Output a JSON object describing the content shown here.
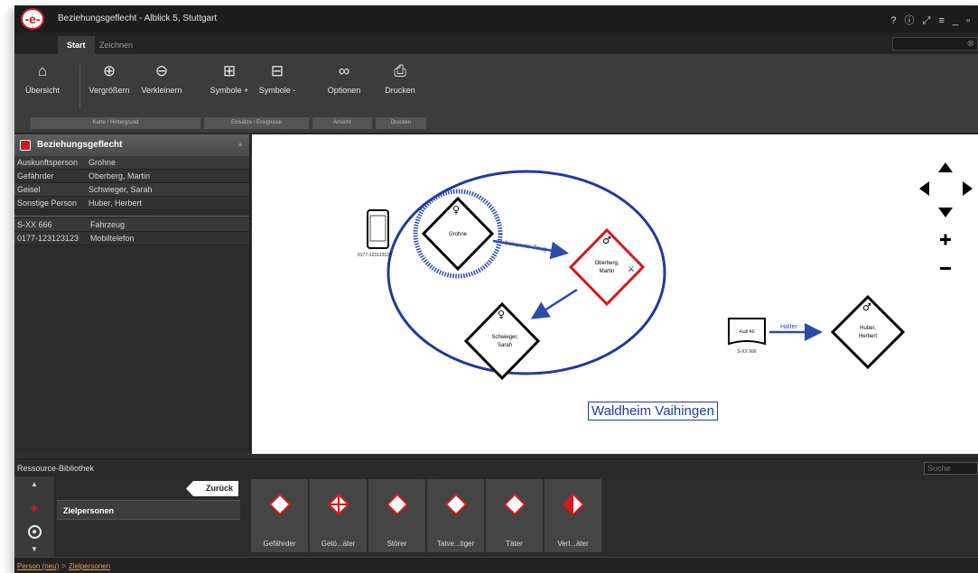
{
  "window": {
    "title": "Beziehungsgeflecht - Alblick 5, Stuttgart",
    "logo": "-e-",
    "controls": "?  ⓘ  ⤢  ≡  _  ▫"
  },
  "tabs": [
    {
      "label": "Start",
      "active": true
    },
    {
      "label": "Zeichnen",
      "active": false
    }
  ],
  "ribbon": {
    "buttons": [
      {
        "label": "Übersicht",
        "icon": "home-icon"
      },
      {
        "label": "Vergrößern",
        "icon": "zoom-in-icon"
      },
      {
        "label": "Verkleinern",
        "icon": "zoom-out-icon"
      },
      {
        "label": "Symbole +",
        "icon": "plus-box-icon"
      },
      {
        "label": "Symbole -",
        "icon": "minus-box-icon"
      },
      {
        "label": "Optionen",
        "icon": "glasses-icon"
      },
      {
        "label": "Drucken",
        "icon": "printer-icon"
      }
    ],
    "groups": [
      "Karte / Hintergrund",
      "Einsätze / Ereignisse",
      "Ansicht",
      "Drucken"
    ]
  },
  "left_panel": {
    "title": "Beziehungsgeflecht",
    "persons": [
      {
        "role": "Auskunftsperson",
        "name": "Grohne"
      },
      {
        "role": "Gefährder",
        "name": "Oberberg, Martin"
      },
      {
        "role": "Geisel",
        "name": "Schwieger, Sarah"
      },
      {
        "role": "Sonstige Person",
        "name": "Huber, Herbert"
      }
    ],
    "objects": [
      {
        "id": "S-XX 666",
        "type": "Fahrzeug"
      },
      {
        "id": "0177-123123123",
        "type": "Mobiltelefon"
      }
    ]
  },
  "canvas": {
    "area_label": "Waldheim Vaihingen",
    "phone_label": "0177-123123123",
    "nodes": {
      "grohne": "Grohne",
      "oberberg_1": "Oberberg,",
      "oberberg_2": "Martin",
      "schwieger_1": "Schwieger,",
      "schwieger_2": "Sarah",
      "huber_1": "Huber,",
      "huber_2": "Herbert",
      "car": "Audi A6",
      "car_plate": "S-XX 666"
    },
    "edges": {
      "grohne_oberberg": "bekannte Zeug",
      "car_huber": "Halter"
    }
  },
  "resource_library": {
    "title": "Ressource-Bibliothek",
    "search_placeholder": "Suche",
    "back_label": "Zurück",
    "category": "Zielpersonen",
    "tiles": [
      {
        "label": "Gefährder",
        "symbol": "diamond-plain"
      },
      {
        "label": "Getö...äter",
        "symbol": "diamond-cross"
      },
      {
        "label": "Störer",
        "symbol": "diamond-plain"
      },
      {
        "label": "Tatve...tiger",
        "symbol": "diamond-plain"
      },
      {
        "label": "Täter",
        "symbol": "diamond-plain"
      },
      {
        "label": "Verl...äter",
        "symbol": "diamond-half"
      }
    ]
  },
  "breadcrumb": {
    "item1": "Person (neu)",
    "separator": ">",
    "item2": "Zielpersonen"
  },
  "colors": {
    "accent_red": "#d2191e",
    "edge_blue": "#2d4aa7",
    "area_blue": "#1f3b9e"
  }
}
